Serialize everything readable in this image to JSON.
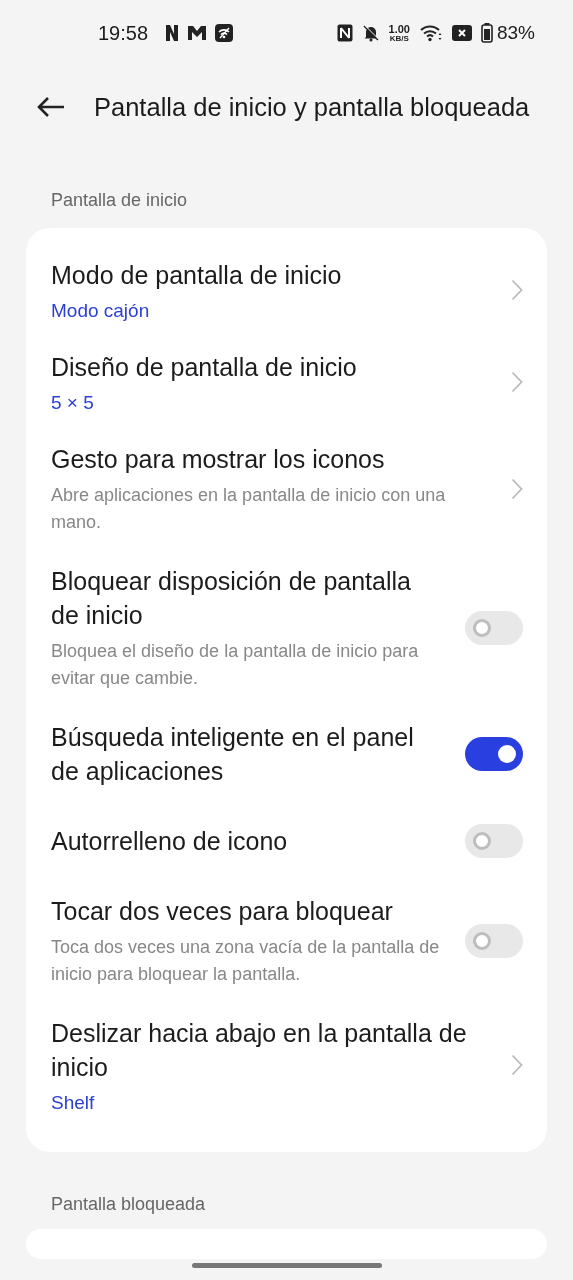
{
  "status_bar": {
    "time": "19:58",
    "net_speed_value": "1.00",
    "net_speed_unit": "KB/S",
    "battery": "83%"
  },
  "header": {
    "title": "Pantalla de inicio y pantalla bloqueada"
  },
  "sections": [
    {
      "title": "Pantalla de inicio",
      "items": [
        {
          "kind": "nav",
          "title": "Modo de pantalla de inicio",
          "value": "Modo cajón"
        },
        {
          "kind": "nav",
          "title": "Diseño de pantalla de inicio",
          "value": "5 × 5"
        },
        {
          "kind": "nav",
          "title": "Gesto para mostrar los iconos",
          "description": "Abre aplicaciones en la pantalla de inicio con una mano."
        },
        {
          "kind": "toggle",
          "title": "Bloquear disposición de pantalla de inicio",
          "description": "Bloquea el diseño de la pantalla de inicio para evitar que cambie.",
          "on": false
        },
        {
          "kind": "toggle",
          "title": "Búsqueda inteligente en el panel de aplicaciones",
          "on": true
        },
        {
          "kind": "toggle",
          "title": "Autorrelleno de icono",
          "on": false
        },
        {
          "kind": "toggle",
          "title": "Tocar dos veces para bloquear",
          "description": "Toca dos veces una zona vacía de la pantalla de inicio para bloquear la pantalla.",
          "on": false
        },
        {
          "kind": "nav",
          "title": "Deslizar hacia abajo en la pantalla de inicio",
          "value": "Shelf"
        }
      ]
    },
    {
      "title": "Pantalla bloqueada"
    }
  ]
}
